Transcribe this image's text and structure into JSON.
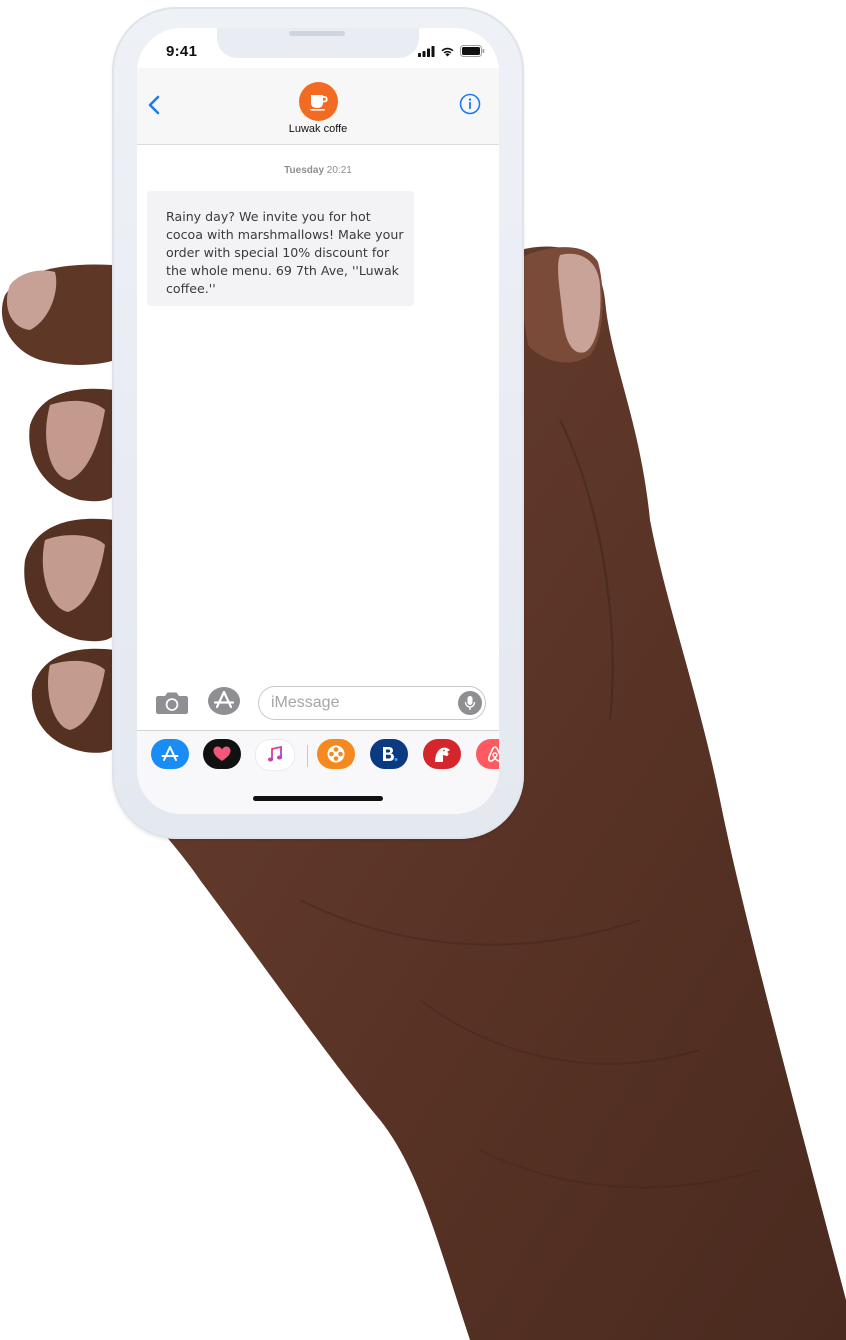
{
  "status_bar": {
    "time": "9:41"
  },
  "header": {
    "contact_name": "Luwak coffe",
    "avatar_color": "#f36b22",
    "accent_color": "#1a7cf0"
  },
  "thread": {
    "timestamp_day": "Tuesday",
    "timestamp_time": "20:21",
    "messages": [
      {
        "text": "Rainy day? We invite you for hot cocoa with marshmallows! Make your order with special 10% discount for the whole menu.  69 7th Ave, ''Luwak coffee.''"
      }
    ]
  },
  "compose": {
    "placeholder": "iMessage"
  },
  "app_drawer": {
    "apps": [
      {
        "name": "app-store-icon",
        "color": "#1a8cf5"
      },
      {
        "name": "heart-sticker-icon",
        "color": "#111111"
      },
      {
        "name": "music-icon",
        "color": "#ffffff"
      },
      {
        "name": "film-reel-icon",
        "color": "#f5891f"
      },
      {
        "name": "booking-icon",
        "color": "#0b3a82"
      },
      {
        "name": "dog-game-icon",
        "color": "#d5262c"
      },
      {
        "name": "airbnb-icon",
        "color": "#ff5a5f"
      }
    ]
  }
}
